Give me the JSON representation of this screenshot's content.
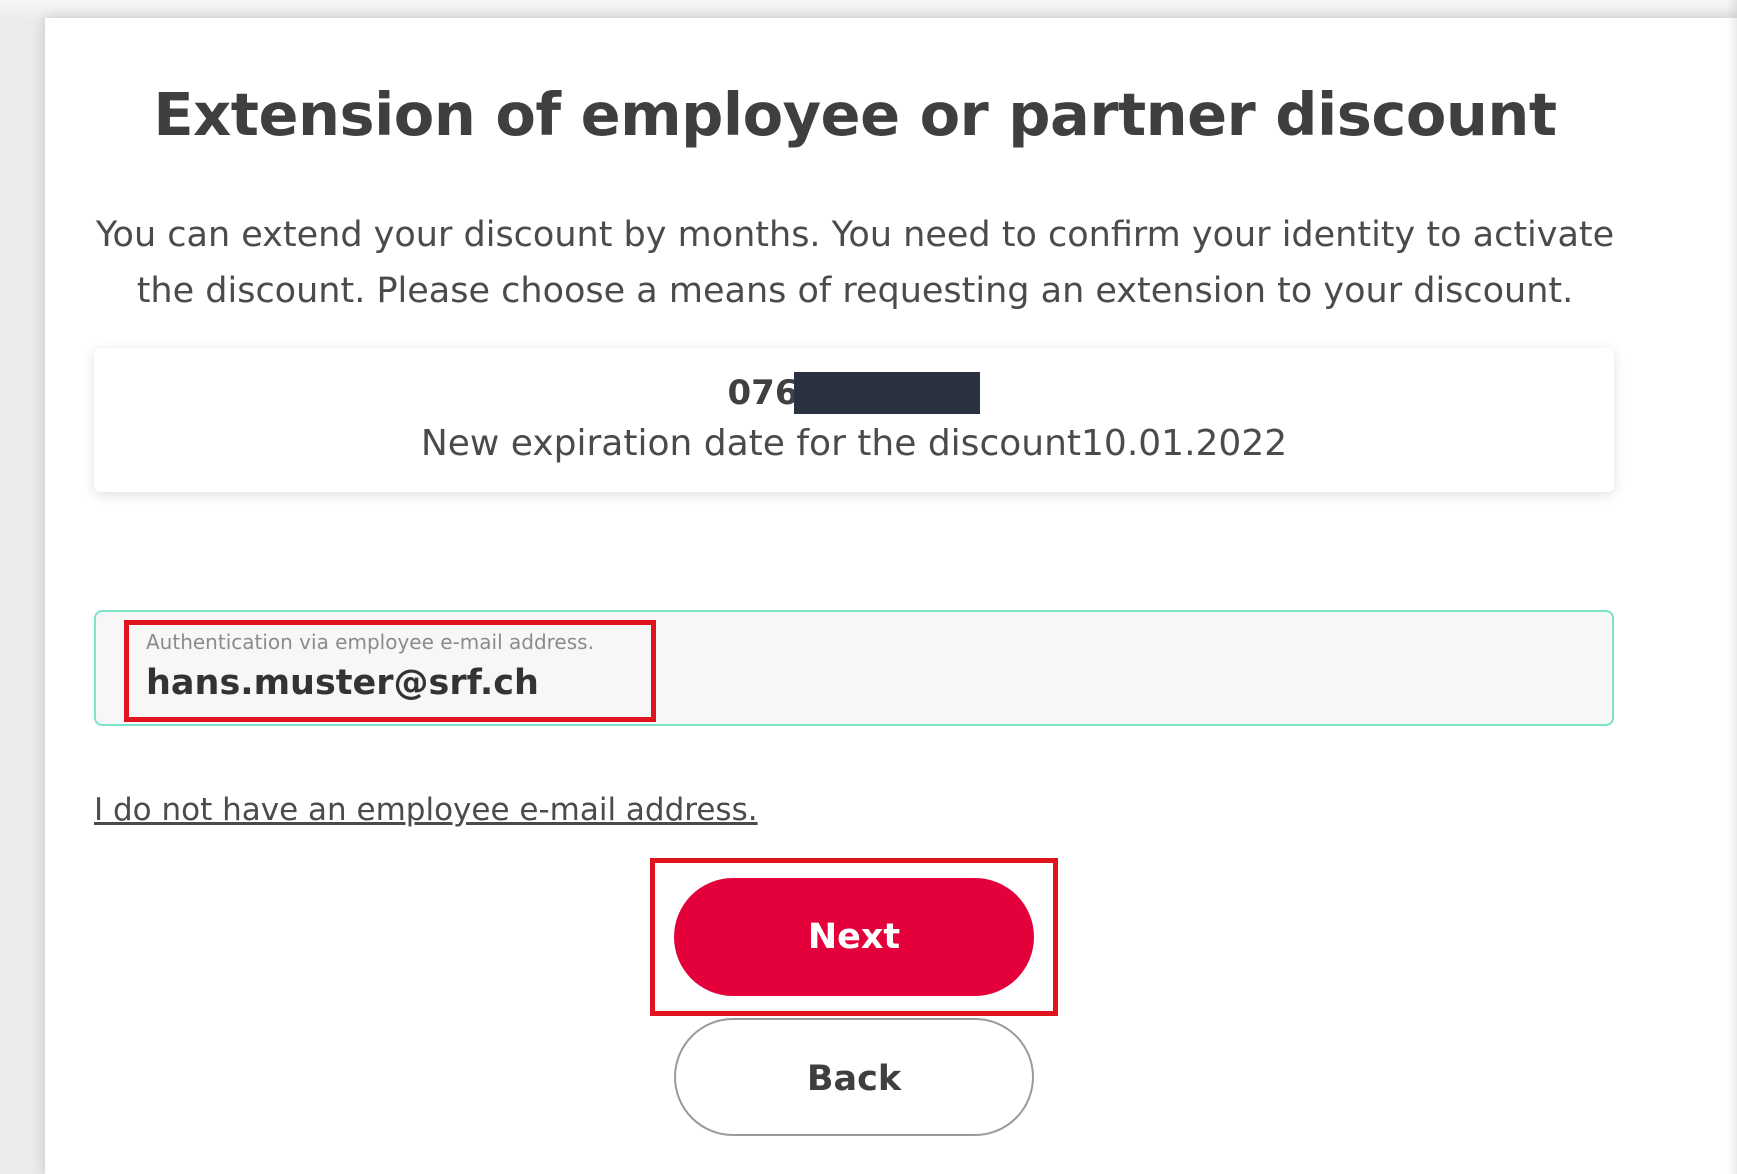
{
  "page": {
    "title": "Extension of employee or partner discount",
    "intro": "You can extend your discount by months. You need to confirm your identity to activate the discount. Please choose a means of requesting an extension to your discount."
  },
  "info_box": {
    "phone_visible": "076",
    "expiration_label": "New expiration date for the discount",
    "expiration_date": "10.01.2022"
  },
  "auth_field": {
    "label": "Authentication via employee e-mail address.",
    "value": "hans.muster@srf.ch"
  },
  "links": {
    "no_employee_email": "I do not have an employee e-mail address."
  },
  "buttons": {
    "next": "Next",
    "back": "Back"
  },
  "colors": {
    "accent": "#e4003b",
    "field_border": "#7de3c8",
    "highlight": "#e0141e",
    "redaction": "#2a3140"
  }
}
